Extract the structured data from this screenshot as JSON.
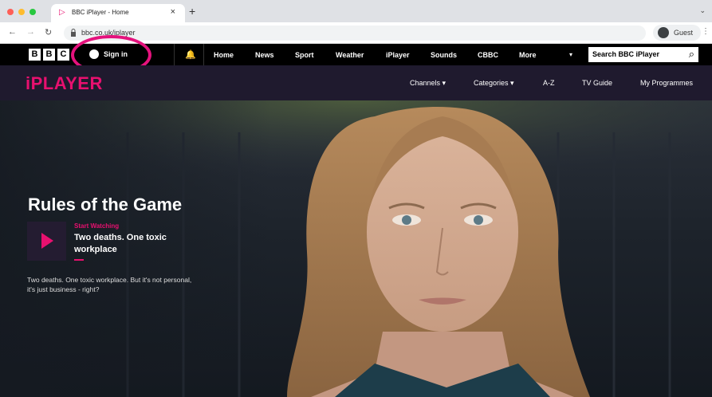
{
  "browser": {
    "tab_title": "BBC iPlayer - Home",
    "url": "bbc.co.uk/iplayer",
    "profile_label": "Guest"
  },
  "bbc_nav": {
    "logo_letters": [
      "B",
      "B",
      "C"
    ],
    "sign_in": "Sign in",
    "links": [
      "Home",
      "News",
      "Sport",
      "Weather",
      "iPlayer",
      "Sounds",
      "CBBC",
      "More"
    ],
    "search_placeholder": "Search BBC iPlayer"
  },
  "iplayer": {
    "logo": "iPLAYER",
    "nav": [
      "Channels ▾",
      "Categories ▾",
      "A-Z",
      "TV Guide",
      "My Programmes"
    ]
  },
  "hero": {
    "title": "Rules of the Game",
    "start_label": "Start Watching",
    "episode_title": "Two deaths. One toxic workplace",
    "synopsis": "Two deaths. One toxic workplace. But it's not personal, it's just business - right?"
  },
  "colors": {
    "accent": "#e8106f",
    "header_bg": "#1f1a2e",
    "annotation": "#e5127d"
  }
}
